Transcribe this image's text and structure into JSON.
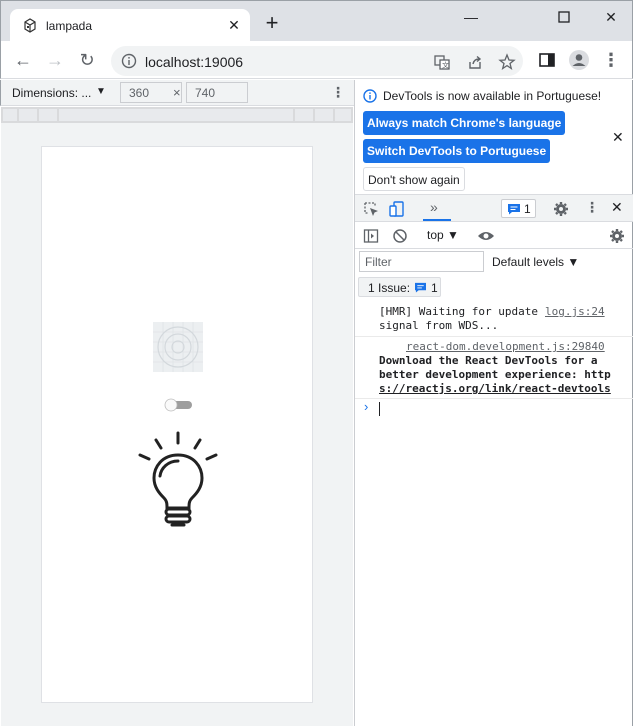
{
  "browser": {
    "tab_title": "lampada",
    "url": "localhost:19006",
    "colors": {
      "titlebar": "#dee1e6",
      "accent": "#1a73e8"
    }
  },
  "device_toolbar": {
    "dimensions_label": "Dimensions: ...",
    "width": "360",
    "height": "740",
    "times": "×"
  },
  "app": {
    "toggle_on": false
  },
  "devtools": {
    "notice": "DevTools is now available in Portuguese!",
    "btn_match": "Always match Chrome's language",
    "btn_switch": "Switch DevTools to Portuguese",
    "btn_dont_show": "Don't show again",
    "issue_count": "1",
    "context": "top",
    "filter_placeholder": "Filter",
    "levels": "Default levels",
    "issues_label": "1 Issue:",
    "issues_count": "1",
    "logs": [
      {
        "source": "log.js:24",
        "line1": "[HMR] Waiting for update",
        "line2": "signal from WDS..."
      },
      {
        "source": "react-dom.development.js:29840",
        "line1": "Download the React DevTools for a",
        "line2": "better development experience: http",
        "line3": "s://reactjs.org/link/react-devtools"
      }
    ],
    "prompt": "›"
  }
}
